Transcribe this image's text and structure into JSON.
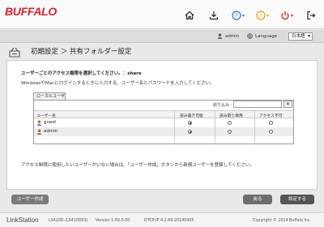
{
  "header": {
    "logo": "BUFFALO",
    "help_mark": "?",
    "info_mark": "!",
    "power_mark": "⏻"
  },
  "subbar": {
    "user": "admin",
    "language_label": "Language",
    "language_value": "日本語"
  },
  "page": {
    "title": "初期設定 ＞ 共有フォルダー設定"
  },
  "content": {
    "prompt": "ユーザーごとのアクセス権限を選択してください。：share",
    "description": "WindowsやMacにログインするときに入力する、ユーザー名とパスワードを入力してください。",
    "group_tab": "ローカルユーザー",
    "filter_label": "絞り込み：",
    "filter_value": "",
    "clear_label": "✕",
    "columns": {
      "name": "ユーザー名",
      "rw": "読み書き可能",
      "ro": "読み取り専用",
      "none": "アクセス不可"
    },
    "users": [
      {
        "name": "guest",
        "permission": "rw"
      },
      {
        "name": "admin",
        "permission": "rw"
      }
    ],
    "note": "アクセス制限に使用したいユーザーがいない場合は、「ユーザー作成」ボタンから新規ユーザーを登録してください。"
  },
  "buttons": {
    "create_user": "ユーザー作成",
    "back": "戻る",
    "next": "設定する"
  },
  "footer": {
    "brand": "LinkStation",
    "model": "LS410D (LS410D03)",
    "version": "Version 1.69-0.00",
    "dtcp": "DTCP-IP 4.2.69-20140405",
    "copyright": "Copyright © 2014 Buffalo Inc."
  },
  "colors": {
    "brand_red": "#e0202a",
    "help_blue": "#2b6fd0",
    "info_orange": "#f0a000",
    "power_red": "#d42020"
  }
}
